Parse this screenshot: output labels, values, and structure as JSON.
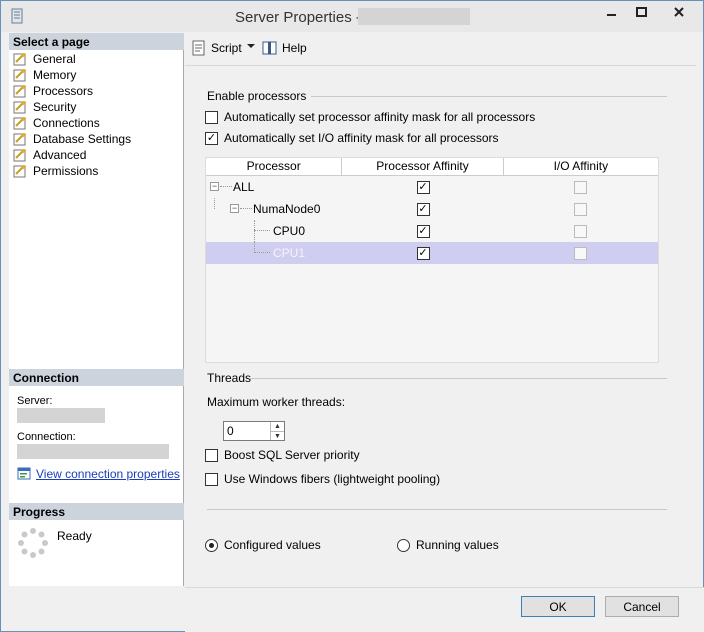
{
  "window": {
    "title": "Server Properties - "
  },
  "left": {
    "select_page_header": "Select a page",
    "pages": [
      {
        "label": "General"
      },
      {
        "label": "Memory"
      },
      {
        "label": "Processors"
      },
      {
        "label": "Security"
      },
      {
        "label": "Connections"
      },
      {
        "label": "Database Settings"
      },
      {
        "label": "Advanced"
      },
      {
        "label": "Permissions"
      }
    ],
    "connection_header": "Connection",
    "server_label": "Server:",
    "connection_label": "Connection:",
    "view_props_link": "View connection properties",
    "progress_header": "Progress",
    "progress_status": "Ready"
  },
  "toolbar": {
    "script_label": "Script",
    "help_label": "Help"
  },
  "processors": {
    "enable_group": "Enable processors",
    "auto_proc_mask": {
      "label": "Automatically set processor affinity mask for all processors",
      "checked": false
    },
    "auto_io_mask": {
      "label": "Automatically set I/O affinity mask for all processors",
      "checked": true
    },
    "grid_headers": [
      "Processor",
      "Processor Affinity",
      "I/O Affinity"
    ],
    "rows": [
      {
        "name": "ALL",
        "affinity": true,
        "io": false
      },
      {
        "name": "NumaNode0",
        "affinity": true,
        "io": false
      },
      {
        "name": "CPU0",
        "affinity": true,
        "io": false
      },
      {
        "name": "CPU1",
        "affinity": true,
        "io": false
      }
    ],
    "threads_group": "Threads",
    "max_worker_label": "Maximum worker threads:",
    "max_worker_value": "0",
    "boost_priority": {
      "label": "Boost SQL Server priority",
      "checked": false
    },
    "use_fibers": {
      "label": "Use Windows fibers (lightweight pooling)",
      "checked": false
    },
    "configured_values": "Configured  values",
    "running_values": "Running values",
    "selected_mode": "configured"
  },
  "footer": {
    "ok_label": "OK",
    "cancel_label": "Cancel"
  }
}
